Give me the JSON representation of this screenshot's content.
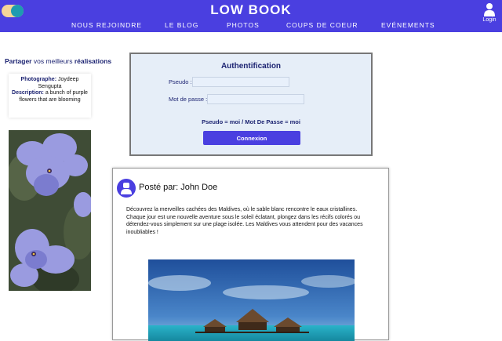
{
  "header": {
    "title": "LOW BOOK",
    "nav": [
      "NOUS REJOINDRE",
      "LE BLOG",
      "PHOTOS",
      "COUPS DE COEUR",
      "EVÉNEMENTS"
    ],
    "login_label": "Login"
  },
  "sidebar": {
    "share_title_bold": "Partager",
    "share_title_plain": " vos meilleurs ",
    "share_title_bold2": "réalisations",
    "photo_card": {
      "photographer_label": "Photographe:",
      "photographer": "Joydeep Sengupta",
      "description_label": "Description:",
      "description": "a bunch of purple flowers that are blooming"
    }
  },
  "auth": {
    "title": "Authentification",
    "pseudo_label": "Pseudo :",
    "password_label": "Mot de passe :",
    "hint": "Pseudo = moi / Mot De Passe = moi",
    "submit_label": "Connexion"
  },
  "post": {
    "author": "Posté par: John Doe",
    "text": "Découvrez la merveilles cachées des Maldives, où le sable blanc rencontre le eaux cristallines. Chaque jour est une nouvelle aventure sous le soleil éclatant, plongez dans les récifs colorés ou détendez-vous simplement sur une plage isolée. Les Maldives vous attendent pour des vacances inoubliables !"
  },
  "colors": {
    "brand": "#4a3fe0",
    "navy_text": "#1d2472",
    "auth_bg": "#e6eef8"
  }
}
